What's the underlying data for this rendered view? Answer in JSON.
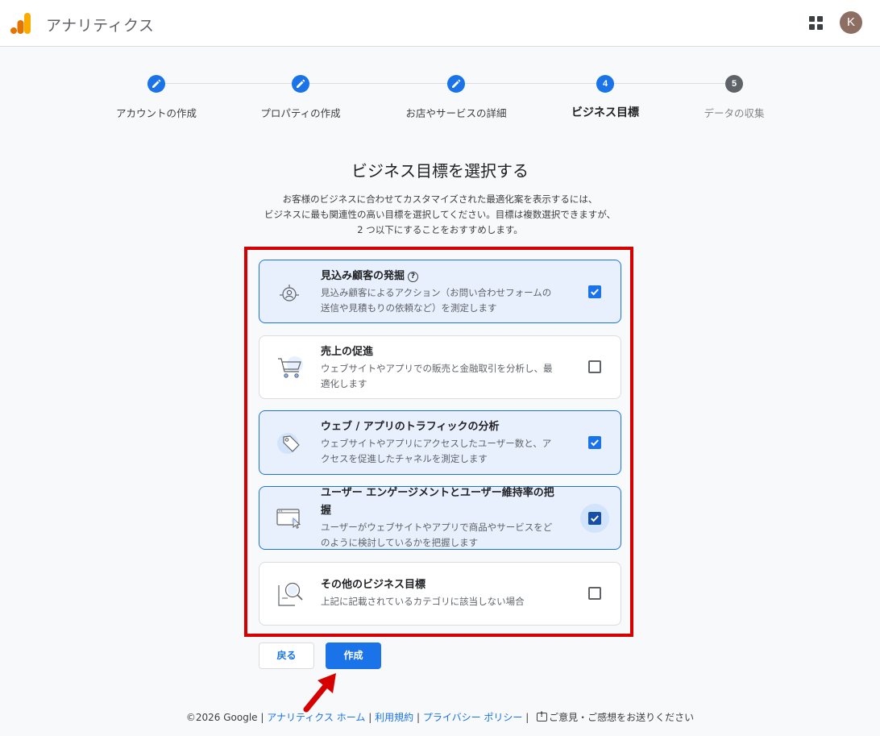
{
  "header": {
    "app_title": "アナリティクス",
    "logo_icon": "analytics-bars-icon",
    "apps_icon": "apps-grid-icon",
    "avatar_letter": "K",
    "brand_colors": {
      "orange": "#f9ab00",
      "dark_orange": "#e37400"
    }
  },
  "stepper": {
    "steps": [
      {
        "label": "アカウントの作成",
        "state": "done",
        "icon": "pencil-icon"
      },
      {
        "label": "プロパティの作成",
        "state": "done",
        "icon": "pencil-icon"
      },
      {
        "label": "お店やサービスの詳細",
        "state": "done",
        "icon": "pencil-icon"
      },
      {
        "label": "ビジネス目標",
        "state": "current",
        "number": "4"
      },
      {
        "label": "データの収集",
        "state": "upcoming",
        "number": "5"
      }
    ]
  },
  "main": {
    "title": "ビジネス目標を選択する",
    "description_lines": [
      "お客様のビジネスに合わせてカスタマイズされた最適化案を表示するには、",
      "ビジネスに最も関連性の高い目標を選択してください。目標は複数選択できますが、",
      "2 つ以下にすることをおすすめします。"
    ],
    "options": [
      {
        "title": "見込み顧客の発掘",
        "help": "?",
        "desc_lines": [
          "見込み顧客によるアクション（お問い合わせフォームの",
          "送信や見積もりの依頼など）を測定します"
        ],
        "checked": true,
        "icon": "target-person-icon"
      },
      {
        "title": "売上の促進",
        "desc_lines": [
          "ウェブサイトやアプリでの販売と金融取引を分析し、最",
          "適化します"
        ],
        "checked": false,
        "icon": "shopping-cart-icon"
      },
      {
        "title": "ウェブ / アプリのトラフィックの分析",
        "desc_lines": [
          "ウェブサイトやアプリにアクセスしたユーザー数と、ア",
          "クセスを促進したチャネルを測定します"
        ],
        "checked": true,
        "icon": "tag-icon"
      },
      {
        "title_lines": [
          "ユーザー エンゲージメントとユーザー維持率の把",
          "握"
        ],
        "desc_lines": [
          "ユーザーがウェブサイトやアプリで商品やサービスをど",
          "のように検討しているかを把握します"
        ],
        "checked": true,
        "icon": "browser-cursor-icon"
      },
      {
        "title": "その他のビジネス目標",
        "desc_lines": [
          "上記に記載されているカテゴリに該当しない場合"
        ],
        "checked": false,
        "icon": "document-search-icon"
      }
    ],
    "back_label": "戻る",
    "create_label": "作成"
  },
  "footer": {
    "copyright": "©2026 Google",
    "links": [
      "アナリティクス ホーム",
      "利用規約",
      "プライバシー ポリシー"
    ],
    "separator": "|",
    "feedback": "ご意見・ご感想をお送りください",
    "feedback_icon": "feedback-icon"
  },
  "colors": {
    "accent": "#1a73e8",
    "selected_bg": "#e8f0fe",
    "highlight_border": "#d60000"
  }
}
